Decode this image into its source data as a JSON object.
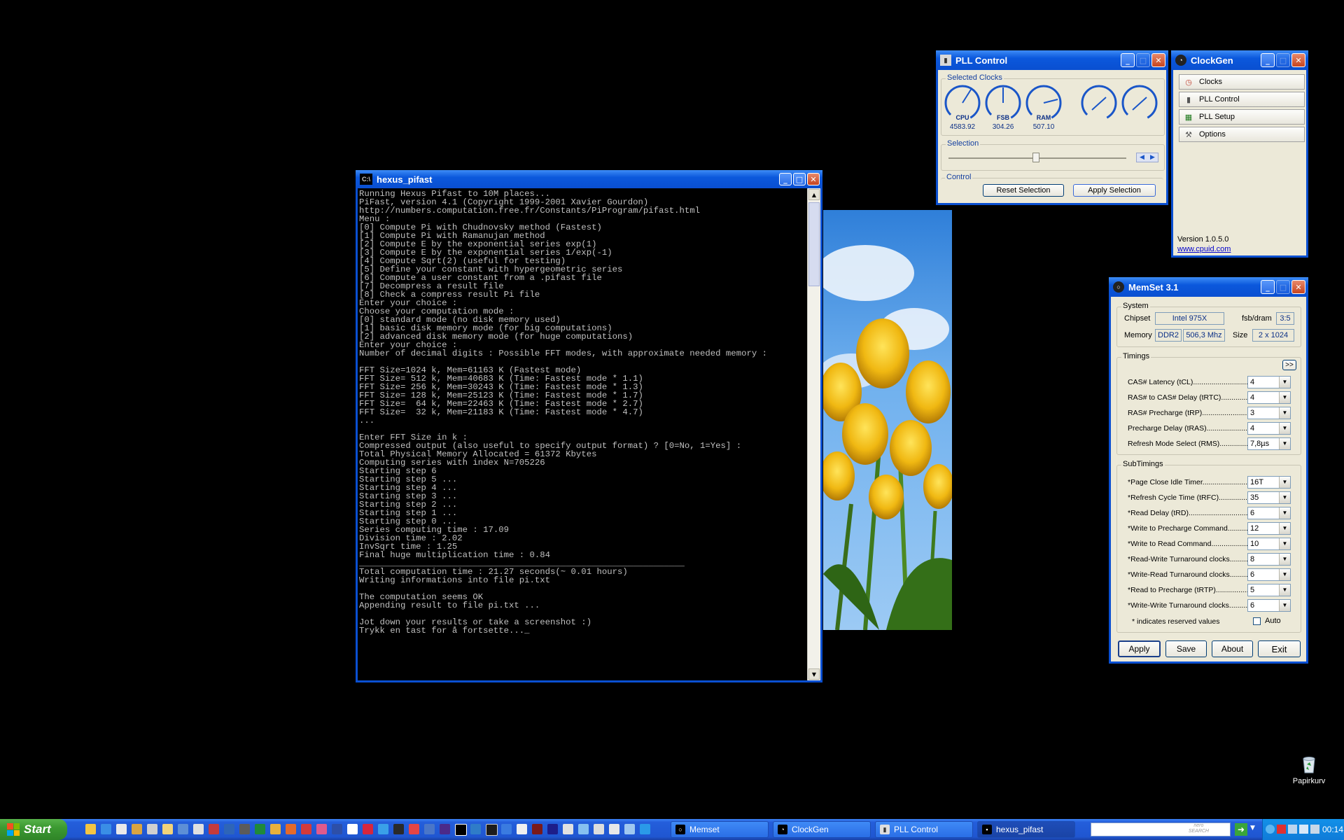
{
  "console": {
    "title": "hexus_pifast",
    "icon": "C:\\",
    "text": "Running Hexus Pifast to 10M places...\nPiFast, version 4.1 (Copyright 1999-2001 Xavier Gourdon)\nhttp://numbers.computation.free.fr/Constants/PiProgram/pifast.html\nMenu :\n[0] Compute Pi with Chudnovsky method (Fastest)\n[1] Compute Pi with Ramanujan method\n[2] Compute E by the exponential series exp(1)\n[3] Compute E by the exponential series 1/exp(-1)\n[4] Compute Sqrt(2) (useful for testing)\n[5] Define your constant with hypergeometric series\n[6] Compute a user constant from a .pifast file\n[7] Decompress a result file\n[8] Check a compress result Pi file\nEnter your choice :\nChoose your computation mode :\n[0] standard mode (no disk memory used)\n[1] basic disk memory mode (for big computations)\n[2] advanced disk memory mode (for huge computations)\nEnter your choice :\nNumber of decimal digits : Possible FFT modes, with approximate needed memory :\n\nFFT Size=1024 k, Mem=61163 K (Fastest mode)\nFFT Size= 512 k, Mem=40683 K (Time: Fastest mode * 1.1)\nFFT Size= 256 k, Mem=30243 K (Time: Fastest mode * 1.3)\nFFT Size= 128 k, Mem=25123 K (Time: Fastest mode * 1.7)\nFFT Size=  64 k, Mem=22463 K (Time: Fastest mode * 2.7)\nFFT Size=  32 k, Mem=21183 K (Time: Fastest mode * 4.7)\n...\n\nEnter FFT Size in k :\nCompressed output (also useful to specify output format) ? [0=No, 1=Yes] :\nTotal Physical Memory Allocated = 61372 Kbytes\nComputing series with index N=705226\nStarting step 6\nStarting step 5 ...\nStarting step 4 ...\nStarting step 3 ...\nStarting step 2 ...\nStarting step 1 ...\nStarting step 0 ...\nSeries computing time : 17.09\nDivision time : 2.02\nInvSqrt time : 1.25\nFinal huge multiplication time : 0.84\n_______________________________________________________________\nTotal computation time : 21.27 seconds(~ 0.01 hours)\nWriting informations into file pi.txt\n\nThe computation seems OK\nAppending result to file pi.txt ...\n\nJot down your results or take a screenshot :)\nTrykk en tast for å fortsette..._"
  },
  "pll": {
    "title": "PLL Control",
    "selected_clocks_label": "Selected Clocks",
    "gauges": [
      {
        "name": "CPU",
        "value": "4583.92"
      },
      {
        "name": "FSB",
        "value": "304.26"
      },
      {
        "name": "RAM",
        "value": "507.10"
      },
      {
        "name": "",
        "value": ""
      },
      {
        "name": "",
        "value": ""
      }
    ],
    "selection_label": "Selection",
    "control_label": "Control",
    "reset_label": "Reset Selection",
    "apply_label": "Apply Selection"
  },
  "clockgen": {
    "title": "ClockGen",
    "items": [
      {
        "label": "Clocks",
        "icon": "clock-icon"
      },
      {
        "label": "PLL Control",
        "icon": "pll-icon"
      },
      {
        "label": "PLL Setup",
        "icon": "chip-icon"
      },
      {
        "label": "Options",
        "icon": "wrench-icon"
      }
    ],
    "version": "Version 1.0.5.0",
    "link": "www.cpuid.com"
  },
  "memset": {
    "title": "MemSet 3.1",
    "system_label": "System",
    "chipset_label": "Chipset",
    "chipset_value": "Intel 975X",
    "fsb_label": "fsb/dram",
    "fsb_value": "3:5",
    "memory_label": "Memory",
    "memory_type": "DDR2",
    "memory_speed": "506,3 Mhz",
    "size_label": "Size",
    "size_value": "2 x 1024",
    "timings_label": "Timings",
    "expand_label": ">>",
    "timings": [
      {
        "label": "CAS# Latency (tCL)....................................",
        "value": "4"
      },
      {
        "label": "RAS# to CAS# Delay (tRTC).................",
        "value": "4"
      },
      {
        "label": "RAS# Precharge (tRP)...........................",
        "value": "3"
      },
      {
        "label": "Precharge Delay  (tRAS)......................",
        "value": "4"
      },
      {
        "label": "Refresh Mode Select (RMS)...................",
        "value": "7,8µs"
      }
    ],
    "subtimings_label": "SubTimings",
    "subtimings": [
      {
        "label": "*Page Close Idle Timer...............................",
        "value": "16T"
      },
      {
        "label": "*Refresh Cycle Time (tRFC)....................",
        "value": "35"
      },
      {
        "label": "*Read Delay (tRD)......................................",
        "value": "6"
      },
      {
        "label": "*Write to Precharge Command..............",
        "value": "12"
      },
      {
        "label": "*Write to Read Command.........................",
        "value": "10"
      },
      {
        "label": "*Read-Write Turnaround clocks...............",
        "value": "8"
      },
      {
        "label": "*Write-Read Turnaround clocks...............",
        "value": "6"
      },
      {
        "label": "*Read to Precharge (tRTP)......................",
        "value": "5"
      },
      {
        "label": "*Write-Write Turnaround clocks...............",
        "value": "6"
      }
    ],
    "reserved_note": "* indicates reserved values",
    "auto_label": "Auto",
    "buttons": {
      "apply": "Apply",
      "save": "Save",
      "about": "About",
      "exit": "Exit"
    }
  },
  "desktop": {
    "recycle_label": "Papirkurv"
  },
  "taskbar": {
    "start_label": "Start",
    "tasks": [
      {
        "label": "Memset",
        "icon": "memset-icon"
      },
      {
        "label": "ClockGen",
        "icon": "clockgen-icon"
      },
      {
        "label": "PLL Control",
        "icon": "pll-icon"
      },
      {
        "label": "hexus_pifast",
        "icon": "console-icon"
      }
    ],
    "search_brand": "nero\nSEARCH",
    "clock": "00:14"
  },
  "colors": {
    "title_bar": "#0a4fd1",
    "window_bg": "#ece9d8",
    "gauge": "#1a56c8",
    "taskbar": "#245edb",
    "start_green": "#3c9a32"
  }
}
